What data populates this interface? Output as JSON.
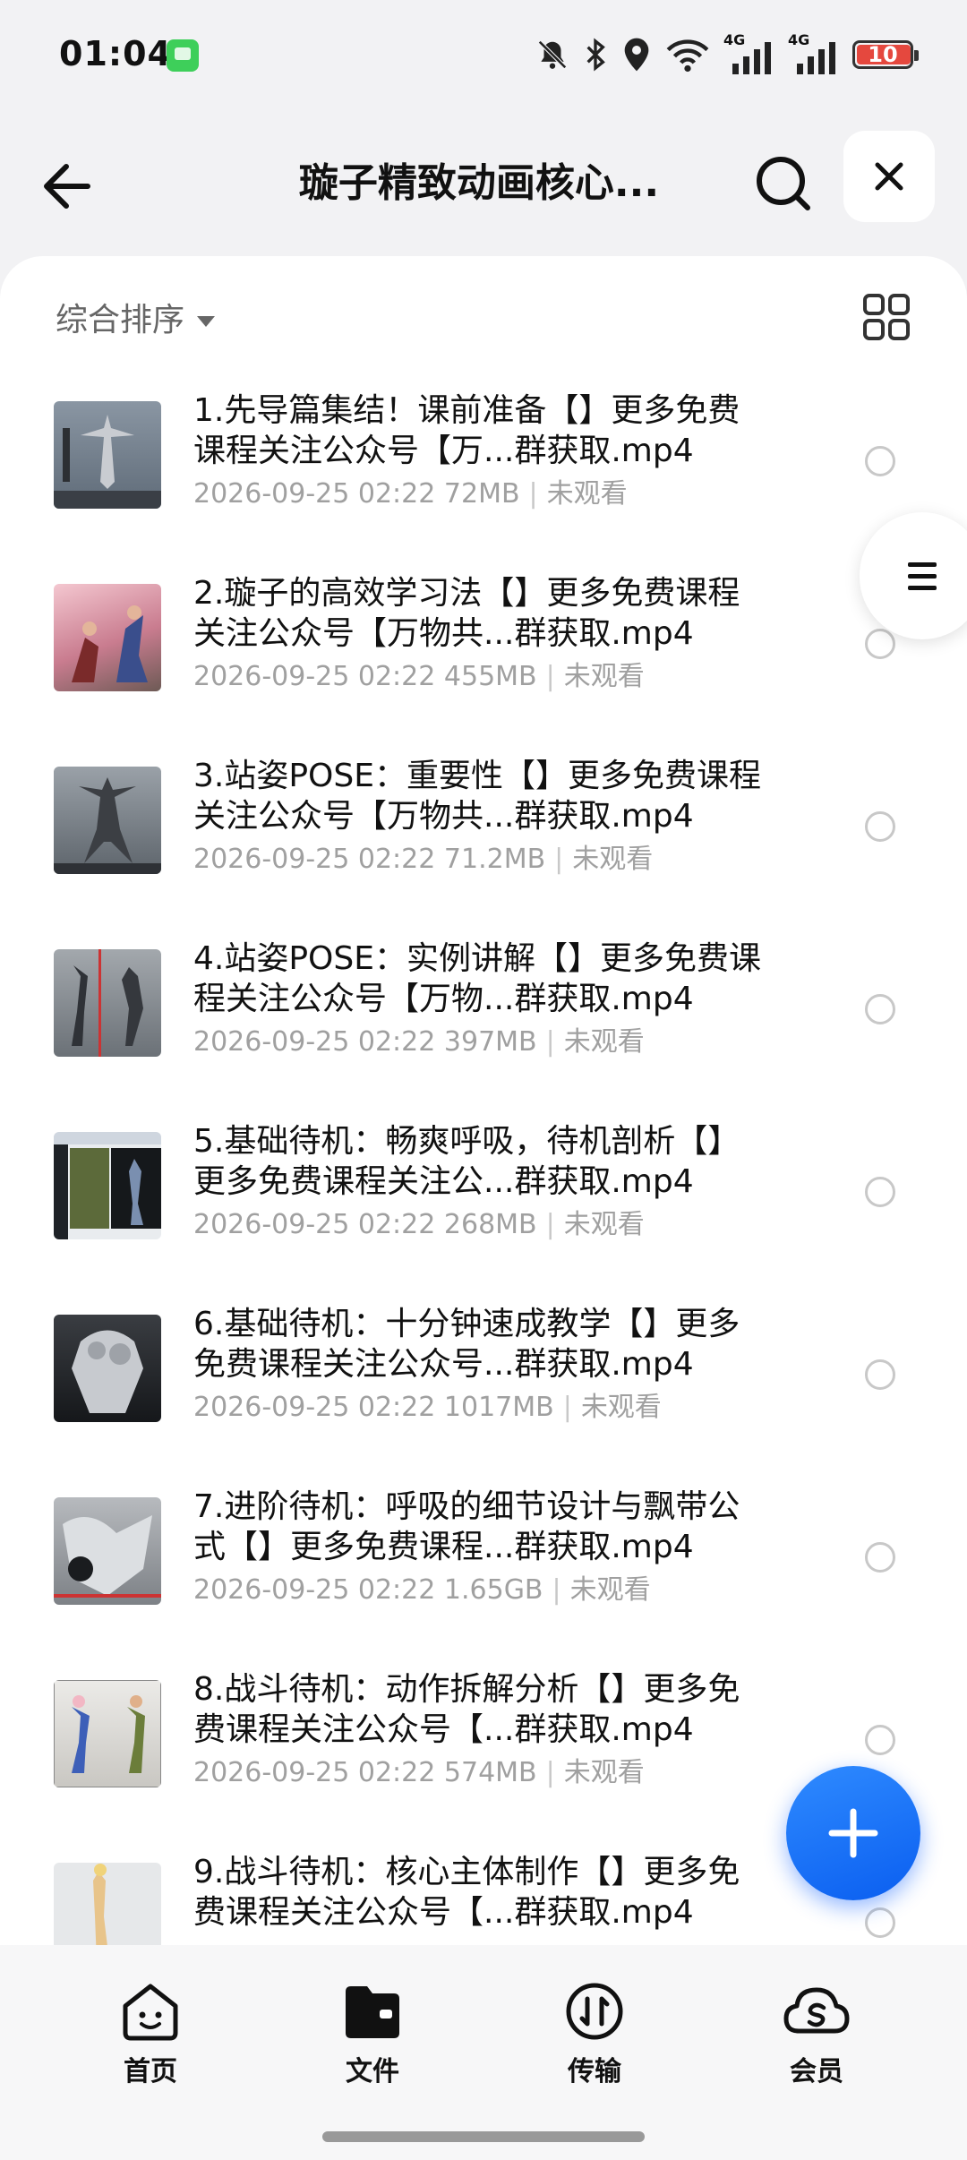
{
  "status_bar": {
    "time": "01:04",
    "battery": "10",
    "icons": [
      "chat-app-icon",
      "mute-bell-icon",
      "bluetooth-icon",
      "location-icon",
      "wifi-icon",
      "signal-4g-icon",
      "signal-4g-icon"
    ],
    "signal_label_1": "4G",
    "signal_label_2": "4G"
  },
  "header": {
    "title": "璇子精致动画核心...",
    "back_icon": "arrow-left-icon",
    "search_icon": "search-icon",
    "close_icon": "close-icon"
  },
  "toolbar": {
    "sort_label": "综合排序",
    "view_icon": "grid-view-icon"
  },
  "files": [
    {
      "title": "1.先导篇集结！课前准备【】更多免费课程关注公众号【万...群获取.mp4",
      "date": "2026-09-25 02:22",
      "size": "72MB",
      "status": "未观看"
    },
    {
      "title": "2.璇子的高效学习法【】更多免费课程关注公众号【万物共...群获取.mp4",
      "date": "2026-09-25 02:22",
      "size": "455MB",
      "status": "未观看"
    },
    {
      "title": "3.站姿POSE：重要性【】更多免费课程关注公众号【万物共...群获取.mp4",
      "date": "2026-09-25 02:22",
      "size": "71.2MB",
      "status": "未观看"
    },
    {
      "title": "4.站姿POSE：实例讲解【】更多免费课程关注公众号【万物...群获取.mp4",
      "date": "2026-09-25 02:22",
      "size": "397MB",
      "status": "未观看"
    },
    {
      "title": "5.基础待机：畅爽呼吸，待机剖析【】更多免费课程关注公...群获取.mp4",
      "date": "2026-09-25 02:22",
      "size": "268MB",
      "status": "未观看"
    },
    {
      "title": "6.基础待机：十分钟速成教学【】更多免费课程关注公众号...群获取.mp4",
      "date": "2026-09-25 02:22",
      "size": "1017MB",
      "status": "未观看"
    },
    {
      "title": "7.进阶待机：呼吸的细节设计与飘带公式【】更多免费课程...群获取.mp4",
      "date": "2026-09-25 02:22",
      "size": "1.65GB",
      "status": "未观看"
    },
    {
      "title": "8.战斗待机：动作拆解分析【】更多免费课程关注公众号【...群获取.mp4",
      "date": "2026-09-25 02:22",
      "size": "574MB",
      "status": "未观看"
    },
    {
      "title": "9.战斗待机：核心主体制作【】更多免费课程关注公众号【...群获取.mp4",
      "date": "",
      "size": "",
      "status": ""
    }
  ],
  "side_menu_icon": "menu-lines-icon",
  "fab_icon": "plus-icon",
  "bottom_nav": {
    "home": "首页",
    "files": "文件",
    "transfer": "传输",
    "member": "会员"
  }
}
